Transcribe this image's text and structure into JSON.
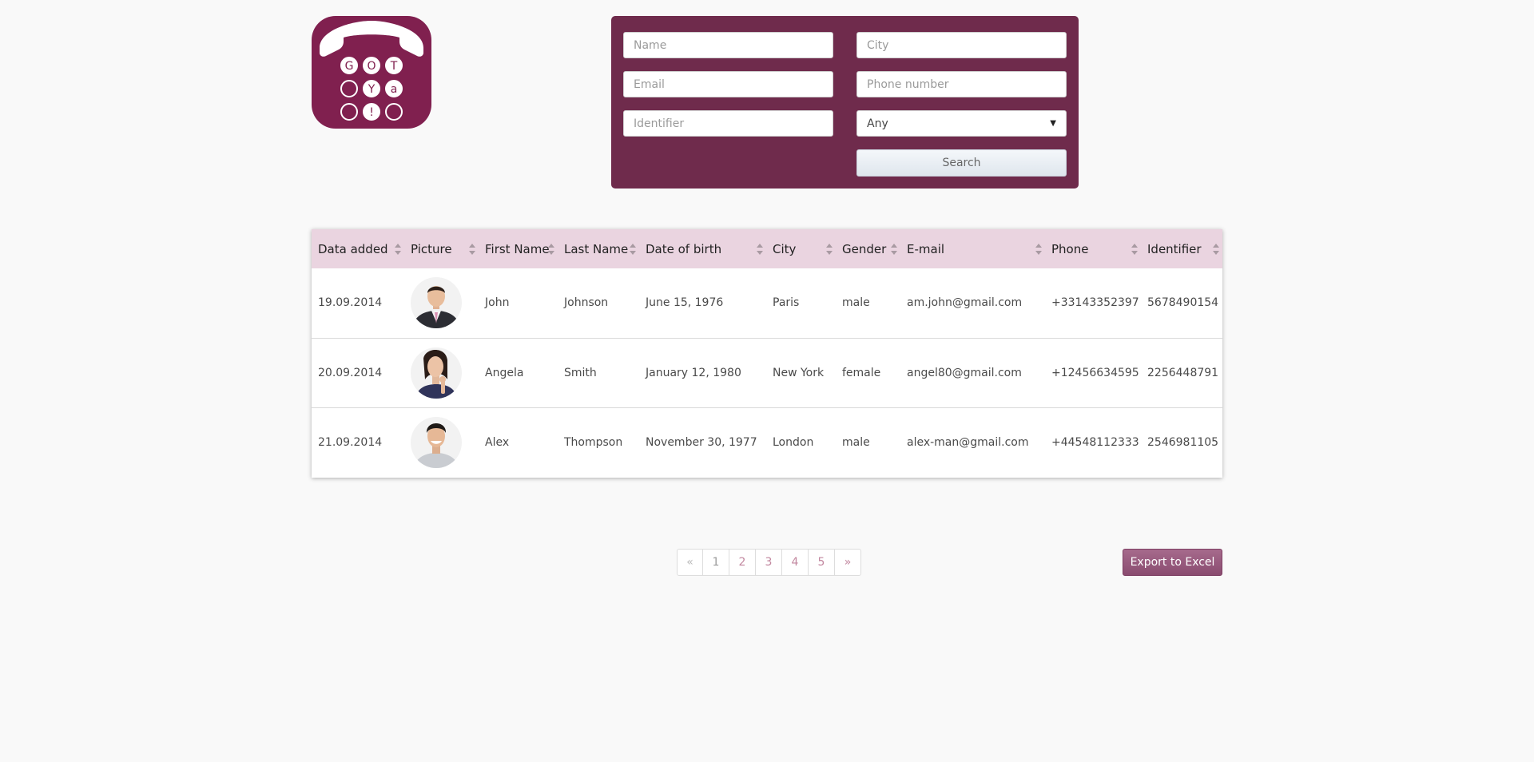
{
  "logo": {
    "letters": [
      "G",
      "O",
      "T",
      "",
      "Y",
      "a",
      "",
      "!",
      ""
    ],
    "brand_color": "#80204f"
  },
  "search_form": {
    "name_placeholder": "Name",
    "city_placeholder": "City",
    "email_placeholder": "Email",
    "phone_placeholder": "Phone number",
    "identifier_placeholder": "Identifier",
    "gender_select": "Any",
    "search_label": "Search",
    "panel_color": "#6f2b4c"
  },
  "table": {
    "columns": [
      "Data added",
      "Picture",
      "First Name",
      "Last Name",
      "Date of birth",
      "City",
      "Gender",
      "E-mail",
      "Phone",
      "Identifier"
    ],
    "rows": [
      {
        "date_added": "19.09.2014",
        "picture": "man-in-suit-photo",
        "first_name": "John",
        "last_name": "Johnson",
        "dob": "June 15, 1976",
        "city": "Paris",
        "gender": "male",
        "email": "am.john@gmail.com",
        "phone": "+33143352397",
        "identifier": "5678490154"
      },
      {
        "date_added": "20.09.2014",
        "picture": "woman-thinking-photo",
        "first_name": "Angela",
        "last_name": "Smith",
        "dob": "January 12, 1980",
        "city": "New York",
        "gender": "female",
        "email": "angel80@gmail.com",
        "phone": "+12456634595",
        "identifier": "2256448791"
      },
      {
        "date_added": "21.09.2014",
        "picture": "smiling-man-photo",
        "first_name": "Alex",
        "last_name": "Thompson",
        "dob": "November 30, 1977",
        "city": "London",
        "gender": "male",
        "email": "alex-man@gmail.com",
        "phone": "+44548112333",
        "identifier": "2546981105"
      }
    ],
    "header_color": "#ead4e0"
  },
  "pagination": {
    "prev": "«",
    "pages": [
      "1",
      "2",
      "3",
      "4",
      "5"
    ],
    "next": "»"
  },
  "export_label": "Export to Excel"
}
